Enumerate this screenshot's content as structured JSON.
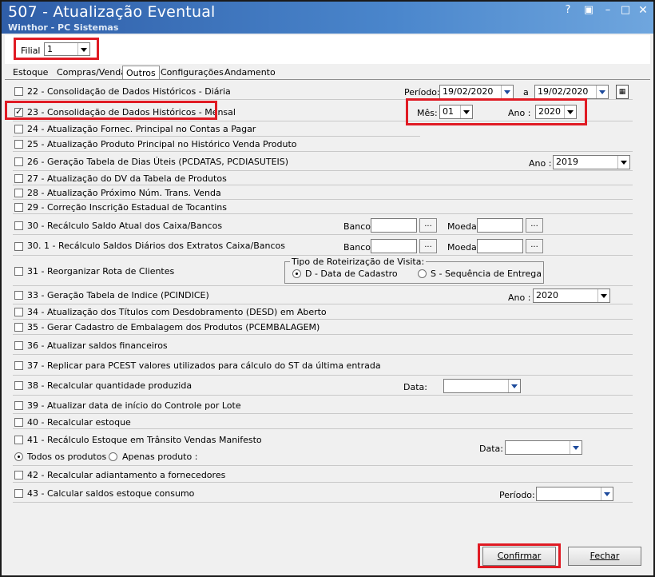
{
  "window": {
    "title": "507 - Atualização Eventual",
    "subtitle": "Winthor - PC Sistemas"
  },
  "filial": {
    "label": "Filial",
    "value": "1"
  },
  "tabs": [
    "Estoque",
    "Compras/Vendas",
    "Outros",
    "Configurações",
    "Andamento"
  ],
  "active_tab": "Outros",
  "rows": {
    "r22": "22 - Consolidação de Dados Históricos - Diária",
    "r23": "23 - Consolidação de Dados Históricos - Mensal",
    "r24": "24 - Atualização Fornec. Principal no Contas a Pagar",
    "r25": "25 - Atualização Produto Principal no Histórico Venda Produto",
    "r26": "26 - Geração Tabela de Dias Úteis (PCDATAS, PCDIASUTEIS)",
    "r27": "27 - Atualização do DV da Tabela de Produtos",
    "r28": "28 - Atualização Próximo Núm. Trans. Venda",
    "r29": "29 - Correção Inscrição Estadual de Tocantins",
    "r30": "30 - Recálculo Saldo Atual dos Caixa/Bancos",
    "r301": "30. 1 - Recálculo Saldos Diários dos Extratos Caixa/Bancos",
    "r31": "31 - Reorganizar Rota de Clientes",
    "r33": "33 - Geração Tabela de Indice (PCINDICE)",
    "r34": "34 - Atualização dos Títulos com Desdobramento (DESD) em Aberto",
    "r35": "35 - Gerar Cadastro de Embalagem dos Produtos (PCEMBALAGEM)",
    "r36": "36 - Atualizar saldos financeiros",
    "r37": "37 - Replicar para PCEST valores utilizados para cálculo do ST da última entrada",
    "r38": "38 - Recalcular quantidade produzida",
    "r39": "39 - Atualizar data de início do Controle por Lote",
    "r40": "40 - Recalcular estoque",
    "r41": "41 - Recálculo Estoque em Trânsito Vendas Manifesto",
    "r42": "42 - Recalcular adiantamento a fornecedores",
    "r43": "43 - Calcular saldos estoque consumo"
  },
  "checked": {
    "r23": true
  },
  "fields": {
    "periodo_label": "Período:",
    "periodo_from": "19/02/2020",
    "periodo_a": "a",
    "periodo_to": "19/02/2020",
    "mes_label": "Mês:",
    "mes_value": "01",
    "ano_label": "Ano :",
    "ano_value": "2020",
    "ano26_label": "Ano :",
    "ano26_value": "2019",
    "banco_label": "Banco",
    "moeda_label": "Moeda",
    "ellipsis": "...",
    "roteirizacao_label": "Tipo de Roteirização de Visita:",
    "rot_opt1": "D - Data de Cadastro",
    "rot_opt2": "S - Sequência de Entrega",
    "ano33_label": "Ano :",
    "ano33_value": "2020",
    "data38_label": "Data:",
    "todos_label": "Todos os produtos",
    "apenas_label": "Apenas produto :",
    "data41_label": "Data:",
    "periodo43_label": "Período:"
  },
  "buttons": {
    "confirmar": "Confirmar",
    "fechar": "Fechar"
  },
  "colors": {
    "title_bar": "#3a6fb8",
    "highlight": "#e01b24",
    "dropdown_arrow": "#1d4a9c"
  }
}
